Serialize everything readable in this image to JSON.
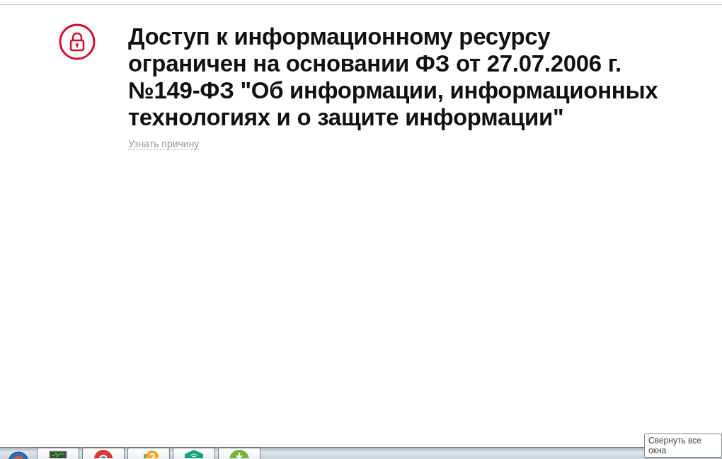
{
  "notice": {
    "title_lines": [
      "Доступ к информационному ресурсу",
      "ограничен на основании ФЗ от 27.07.2006 г.",
      "№149-ФЗ \"Об информации, информационных",
      "технологиях и о защите информации\""
    ],
    "link": "Узнать причину"
  },
  "taskbar": {
    "apps": [
      {
        "kind": "monitor"
      },
      {
        "kind": "browser"
      },
      {
        "kind": "help"
      },
      {
        "kind": "wifi"
      },
      {
        "kind": "torrent"
      }
    ],
    "tooltip": "Свернуть все окна"
  }
}
